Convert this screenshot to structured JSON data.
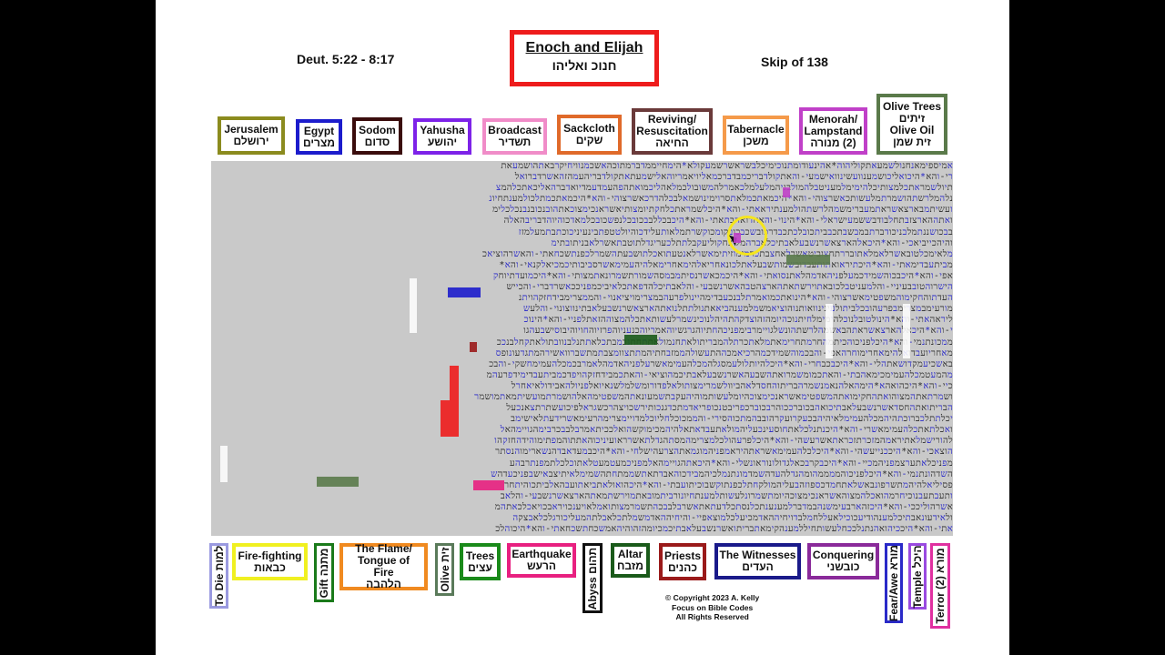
{
  "header": {
    "reference": "Deut. 5:22 - 8:17",
    "title_en": "Enoch and Elijah",
    "title_he": "חנוכ ואליהו",
    "skip": "Skip of 138",
    "title_color": "#ee1c1c"
  },
  "top_keys": [
    {
      "en": "Jerusalem",
      "he": "ירושלם",
      "color": "#8b8b1e"
    },
    {
      "en": "Egypt",
      "he": "מצרים",
      "color": "#1c1ccc"
    },
    {
      "en": "Sodom",
      "he": "סדום",
      "color": "#3a0c0c"
    },
    {
      "en": "Yahusha",
      "he": "יהושע",
      "color": "#7d22e8"
    },
    {
      "en": "Broadcast",
      "he": "תשדיר",
      "color": "#f08cc8"
    },
    {
      "en": "Sackcloth",
      "he": "שקים",
      "color": "#e06a2a"
    },
    {
      "en": "Reviving/ Resuscitation",
      "he": "החיאה",
      "color": "#6a3a3a"
    },
    {
      "en": "Tabernacle",
      "he": "משכן",
      "color": "#f59a4a"
    },
    {
      "en": "Menorah/ Lampstand",
      "he": "(2) מנורה",
      "color": "#c040c8"
    },
    {
      "en": "Olive Trees",
      "he": "זיתים",
      "en2": "Olive Oil",
      "he2": "זית שמן",
      "color": "#5a7a4a"
    }
  ],
  "bottom_keys": [
    {
      "en": "To Die",
      "he": "למות",
      "vertical": true,
      "color": "#9a9ae0"
    },
    {
      "en": "Fire-fighting",
      "he": "כבאות",
      "color": "#f0f020"
    },
    {
      "en": "Gift",
      "he": "מתנה",
      "vertical": true,
      "color": "#1a7a1a"
    },
    {
      "en": "The Flame/ Tongue of Fire",
      "he": "הלהבה",
      "color": "#f08a20"
    },
    {
      "en": "Olive",
      "he": "זית",
      "vertical": true,
      "color": "#5a7a5a"
    },
    {
      "en": "Trees",
      "he": "עצים",
      "color": "#1a8a1a"
    },
    {
      "en": "Earthquake",
      "he": "הרעש",
      "color": "#e82080"
    },
    {
      "en": "Abyss",
      "he": "תהום",
      "vertical": true,
      "color": "#111111"
    },
    {
      "en": "Altar",
      "he": "מזבח",
      "color": "#1a5a1a"
    },
    {
      "en": "Priests",
      "he": "כהנים",
      "color": "#9a1a1a"
    },
    {
      "en": "The Witnesses",
      "he": "העדים",
      "color": "#1a1a8a"
    },
    {
      "en": "Conquering",
      "he": "כובשני",
      "color": "#8a2a9a"
    },
    {
      "en": "Fear/Awe",
      "he": "מורא",
      "vertical": true,
      "color": "#2a2ac8"
    },
    {
      "en": "Temple",
      "he": "היכל",
      "vertical": true,
      "color": "#9a4ae0"
    },
    {
      "en": "Terror",
      "he": "(2) מורא",
      "vertical": true,
      "color": "#e030a0"
    }
  ],
  "copyright": {
    "line1": "© Copyright 2023 A. Kelly",
    "line2": "Focus on Bible Codes",
    "line3": "All Rights Reserved"
  },
  "grid": {
    "rows": [
      "אמיספימאנחנולשמעאתקוליהוה*אהינעודומתנוכימיכלבשראשרשמעקולא*הימחייממדברמתוכהאשכמנוויחיקרבאתהושמעאתכלאשריאמרי",
      "רי-והא*היכואליכושמענוועשינוואישמעי-והאתקולדבריכמבדברכמאליויאמריוהאלישמעתאתקולדבריהעמהזהאשרדברואליכהיטיבוכל",
      "תיולשמראתכלמצותיכלהימימלמעניטבלהמולבניהמלעלמלכאמרלהמשובולכמלאהליכמואתהפהעמדעמדיואדברהאליכאתכלהמצוהוהחקימוה",
      "נלהמלרשתהושמרתמלעשותכאשרצוהי-והא*היכמאתכמלאתסרוימינושמאלבכלהדרכאשרצוהי-והא*היכמאתכמתלכולמענתחיונוטובלכמוהאר",
      "ועשיתמבארצאשראתמעברימשמהלרשתהולמענתיראאתי-והא*היכלשמראתכלחקתיומצותיאשראנכימצוכאתהובנכובנבנכלכלימיחיכולמעניארכנ",
      "ואתההארצזבתחלבודבששמעישראלי-והא*הינוי-והאחדואהבתאתי-והא*היכבכללבבכובכלנפשכובכלמאדכוהיוהדבריבהאלהאשראנכימצוכהיומעלל",
      "בבכושננתמלבניכודברתבמבשבתכבביתכובלכתכבדרכובשכבכובקומכוקשרתמלאותעלידכוהיולטטפתבינעיניכוכתבתמעלמזזותביתכובשעריכו",
      "והיהכייביאכי-והא*היכאלהארצאשרנשבעלאבתיכלאברהמליצחקוליעקבלתתלכעריגדלתוטבתאשרלאבניתובתימ",
      "מלאימכלטובאשרלאמלאתובררתחצוביטאשרלאחצבתכרמימוזיתימאשרלאנטעתואכלתושבעתהשמרלכפנתשכחאתי-והאשרהוציאכמארצמצרימ",
      "מביתעבדימאתי-והא*היכתיראואתותעבדובשמותשבעלאתלכונאחריאלהימאחרימאלהיהעמימאשרסביבותיכמכיאלקנאי-והא*היכבקרבכפניחרה",
      "אפי-והא*היכבכוהשמידכמעלפניהאדמהלאתנסואתי-והא*היכמכאשרנסיתמבמסהשמורתשמרונאתמצותי-והא*היכמועדתיוחקיואשרצוכועשית",
      "הישרוהטובבעיניי-והלמעניטבלכובאתוירשתאתהארצהטבהאשרנשבעי-והלאבתיכלהדפאתכלאיביכמפניככאשרדברי-והכיישאלכבנכמחרלאמרמה",
      "העדתוהחקימוהמשפטימאשרצוהי-והא*הינואתכמואמרתלבנכעבדימהיינולפרעהבמצרימויציאנוי-והממצרימבידחזקהויתני-והאותתומפתימגדלי",
      "מורעימבמצרימבפרעהובכלביתולעינינוואותנוהוציאמשמלמענהביאאתנולתתלנואתהארצאשרנשבעלאבתינווצונוי-והלעשותאתכלהחקימהאלה",
      "ליראהאתי-והא*הינולטובלנוכלהימימלחיתנוכהיומהזהוצדקהתהיהלנוכינשמרלעשותאתכלהמצוההזאתלפניי-והא*הינוכאשרצונוכייביאכ",
      "י-והא*היכאלהארצאשראתהבאשמהלרשתהונשלגויימרבימפניכהחתיוהגרגשיוהאמריוהכנעניוהפרזיוהחויוהיבוסישבעהגויימרבימועצומ",
      "ממכונתנמי-והא*היכלפניכוהכיתמהחרמתחרימאתמלאתכרתלהמבריתולאתחנמולאתתחתנבמבתכלאתתנלבנוובתולאתקחלבנככייסיראתבנכ",
      "מאחריועבדואלהימאחרימוחרהאפי-והבכמוהשמידכמהרכיאמכההתעשולהממזבחתיהמתתצוומצבתמתשברוואשירהמתגדעונופסיליהמתשרפונ",
      "באשכיעמקדושאתהלי-והא*היכבכבחרי-והא*היכלהיותלולעמסגלהמכלהעמימאשרעלפניהאדמהלאמרבכמכלהעמימחשקי-והבכמויבחרבכמכיאת",
      "מהמעטמכלהעמימכימאהבתי-והאתכמומשמרואתהשבעהאשרנשבעלאבתיכמהוציאי-והאתכמבידחזקהויפדכמביתעבדימידפרעהמלכמצרימוידעת",
      "כיי-והא*היכהואהא*הימהאלהנאמנשמרהבריתוהחסדלאהביוולשמרימצותולאלפדורומשלמלשנאיואלפניולהאבידולאיאחרלשנאואלפניוישלמלו",
      "ושמרתאתהמצוהואתהחקימואתהמשפטימאשראנכימצוכהיומלעשותמוהיהעקבתשמעונאתהמשפטימהאלהושמרתמועשיתמאתמושמרי-והא*היכלכאת",
      "הבריתואתהחסדאשרנשבעלאבתיכואהבכוברככוהרבכוברכפריבטנכופריאדמתכדגנכותירשכויצהרכשגראלפיכועשתרתצאנכעלהאדמהאשרנשבעלאבת",
      "יכלתתלכברוכתהיהמכלהעמימלאיהיהבכעקרועקרהובבהמתכוהסירי-והממכוכלחליוכלמדויימצרימהרעימאשרידעתלאישימבכונתנמבכלשנאיכ",
      "ואכלתאתכלהעמימאשרי-והא*היכנתנלכלאתחוסעינכעליהמולאתעבדאתאלהיהמכימוקשהואלככיתאמרבלבבכרבימהגויימהאלהממנייאיכהאוכל",
      "להורישמלאתיראמהמזכרתזכראתאשרעשהי-והא*היכלפרעהולכלמצרימהמסתהגדלתאשרראועיניכוהאתתוהמפתימוהידהחזקהוהזרועהנטויהאשר",
      "הוצאכי-והא*היככנייעשהי-והא*היכלכלהעמימאשראתהיראמפניהמוגמאתהצרעהישלחי-והא*היכבמעדאבדהנשארימוהנסתרימ",
      "מפניכלאתערצמפניהמכיי-והא*היכבקרבכאלגדולונוראונשלי-והא*היכאתהגויימהאלמפניכמעטמעטלאתוכלכלתמפנתרבהעליכחית",
      "השדהונתנמי-והא*היכלפניכוהממממהומהגדלהעדהשמדמונתנמלכיהמבידכוהאבדתאתשממתחתהשמימלאיתיצבאישבפניכעדהשמדכאתמ",
      "פסיליאלהיהמתשרפונבאשלאתחמדכספוזהבעליהמולקחתלכפנתוקשבוכיתועבתי-והא*היכהואולאתביאתועבהאלביתכוהיתחרמכמהושקצתשקצנ",
      "ותעבתעבנוכיחרמהואכלהמצוהאשראנכימצוכהיומתשמרונלעשותלמענתחיונורביתמובאתמוירשתמאתהארצאשרנשבעי-והלאבתיכמוזכרתאתכלהדרכ",
      "אשרהוליככי-והא*היכזהארבעימשנהבמדברלמענענתכלנסתכלדעתאתאשרבלבבכהתשמרמצותואמלאויענכויראבכויאכלכאתהמנאשרלאידעת",
      "ולאידעונאבתיכלמענהודיעכוכילאעללחמלבדויחיההאדמכיעלכלמוצאפיי-והיחיההאדמשמלתכלאבלתהמעליכורגלכלאבצקהזהארבעימשנה",
      "אתי-והא*היככיהואהנתנלככחלעשותחיללמענהקימאתבריתואשרנשבעלאבתיכמכיומהזהוהיהאמשכחתשכחאתי-והא*היכוהלכתאחריאלהימאחרימ"
    ]
  },
  "highlights": [
    {
      "word": "זיתים",
      "meaning": "Olive Trees",
      "color": "#5a7a4a"
    },
    {
      "word": "מזבח",
      "meaning": "Altar",
      "color": "#1a5a1a"
    },
    {
      "word": "מצרים",
      "meaning": "Egypt",
      "color": "#1c1ccc"
    },
    {
      "word": "הרעש",
      "meaning": "Earthquake",
      "color": "#e82080"
    },
    {
      "word": "זיתשמנ",
      "meaning": "Olive Oil",
      "color": "#5a7a4a"
    },
    {
      "word": "הלהבה",
      "meaning": "The Flame",
      "color": "#ee1c1c"
    }
  ]
}
